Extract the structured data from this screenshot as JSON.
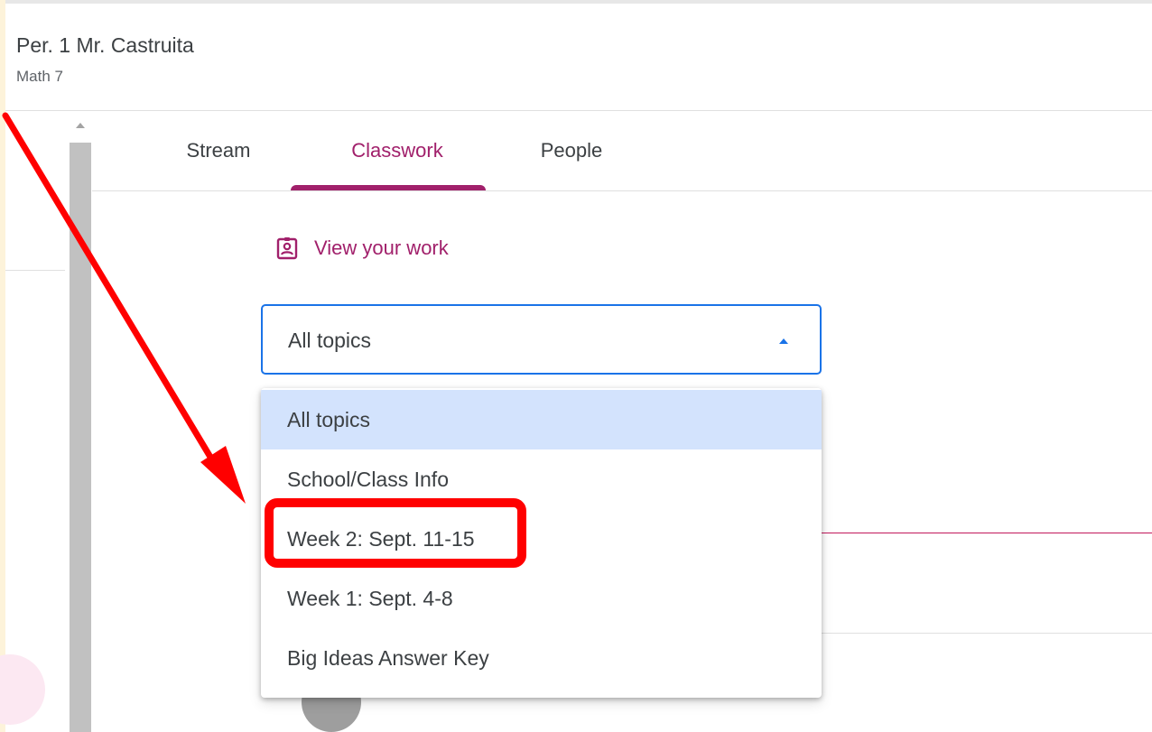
{
  "class": {
    "title": "Per. 1 Mr. Castruita",
    "subtitle": "Math 7"
  },
  "tabs": [
    {
      "label": "Stream",
      "active": false
    },
    {
      "label": "Classwork",
      "active": true
    },
    {
      "label": "People",
      "active": false
    }
  ],
  "view_work": {
    "label": "View your work",
    "icon": "assignment-ind-icon"
  },
  "topic_filter": {
    "selected": "All topics",
    "expanded": true,
    "options": [
      "All topics",
      "School/Class Info",
      "Week 2: Sept. 11-15",
      "Week 1: Sept. 4-8",
      "Big Ideas Answer Key"
    ]
  },
  "annotation": {
    "highlighted_option": "Week 2: Sept. 11-15",
    "color": "#ff0000"
  },
  "colors": {
    "accent": "#a1206b",
    "focus_border": "#1a73e8",
    "selected_option_bg": "#d3e3fd"
  }
}
